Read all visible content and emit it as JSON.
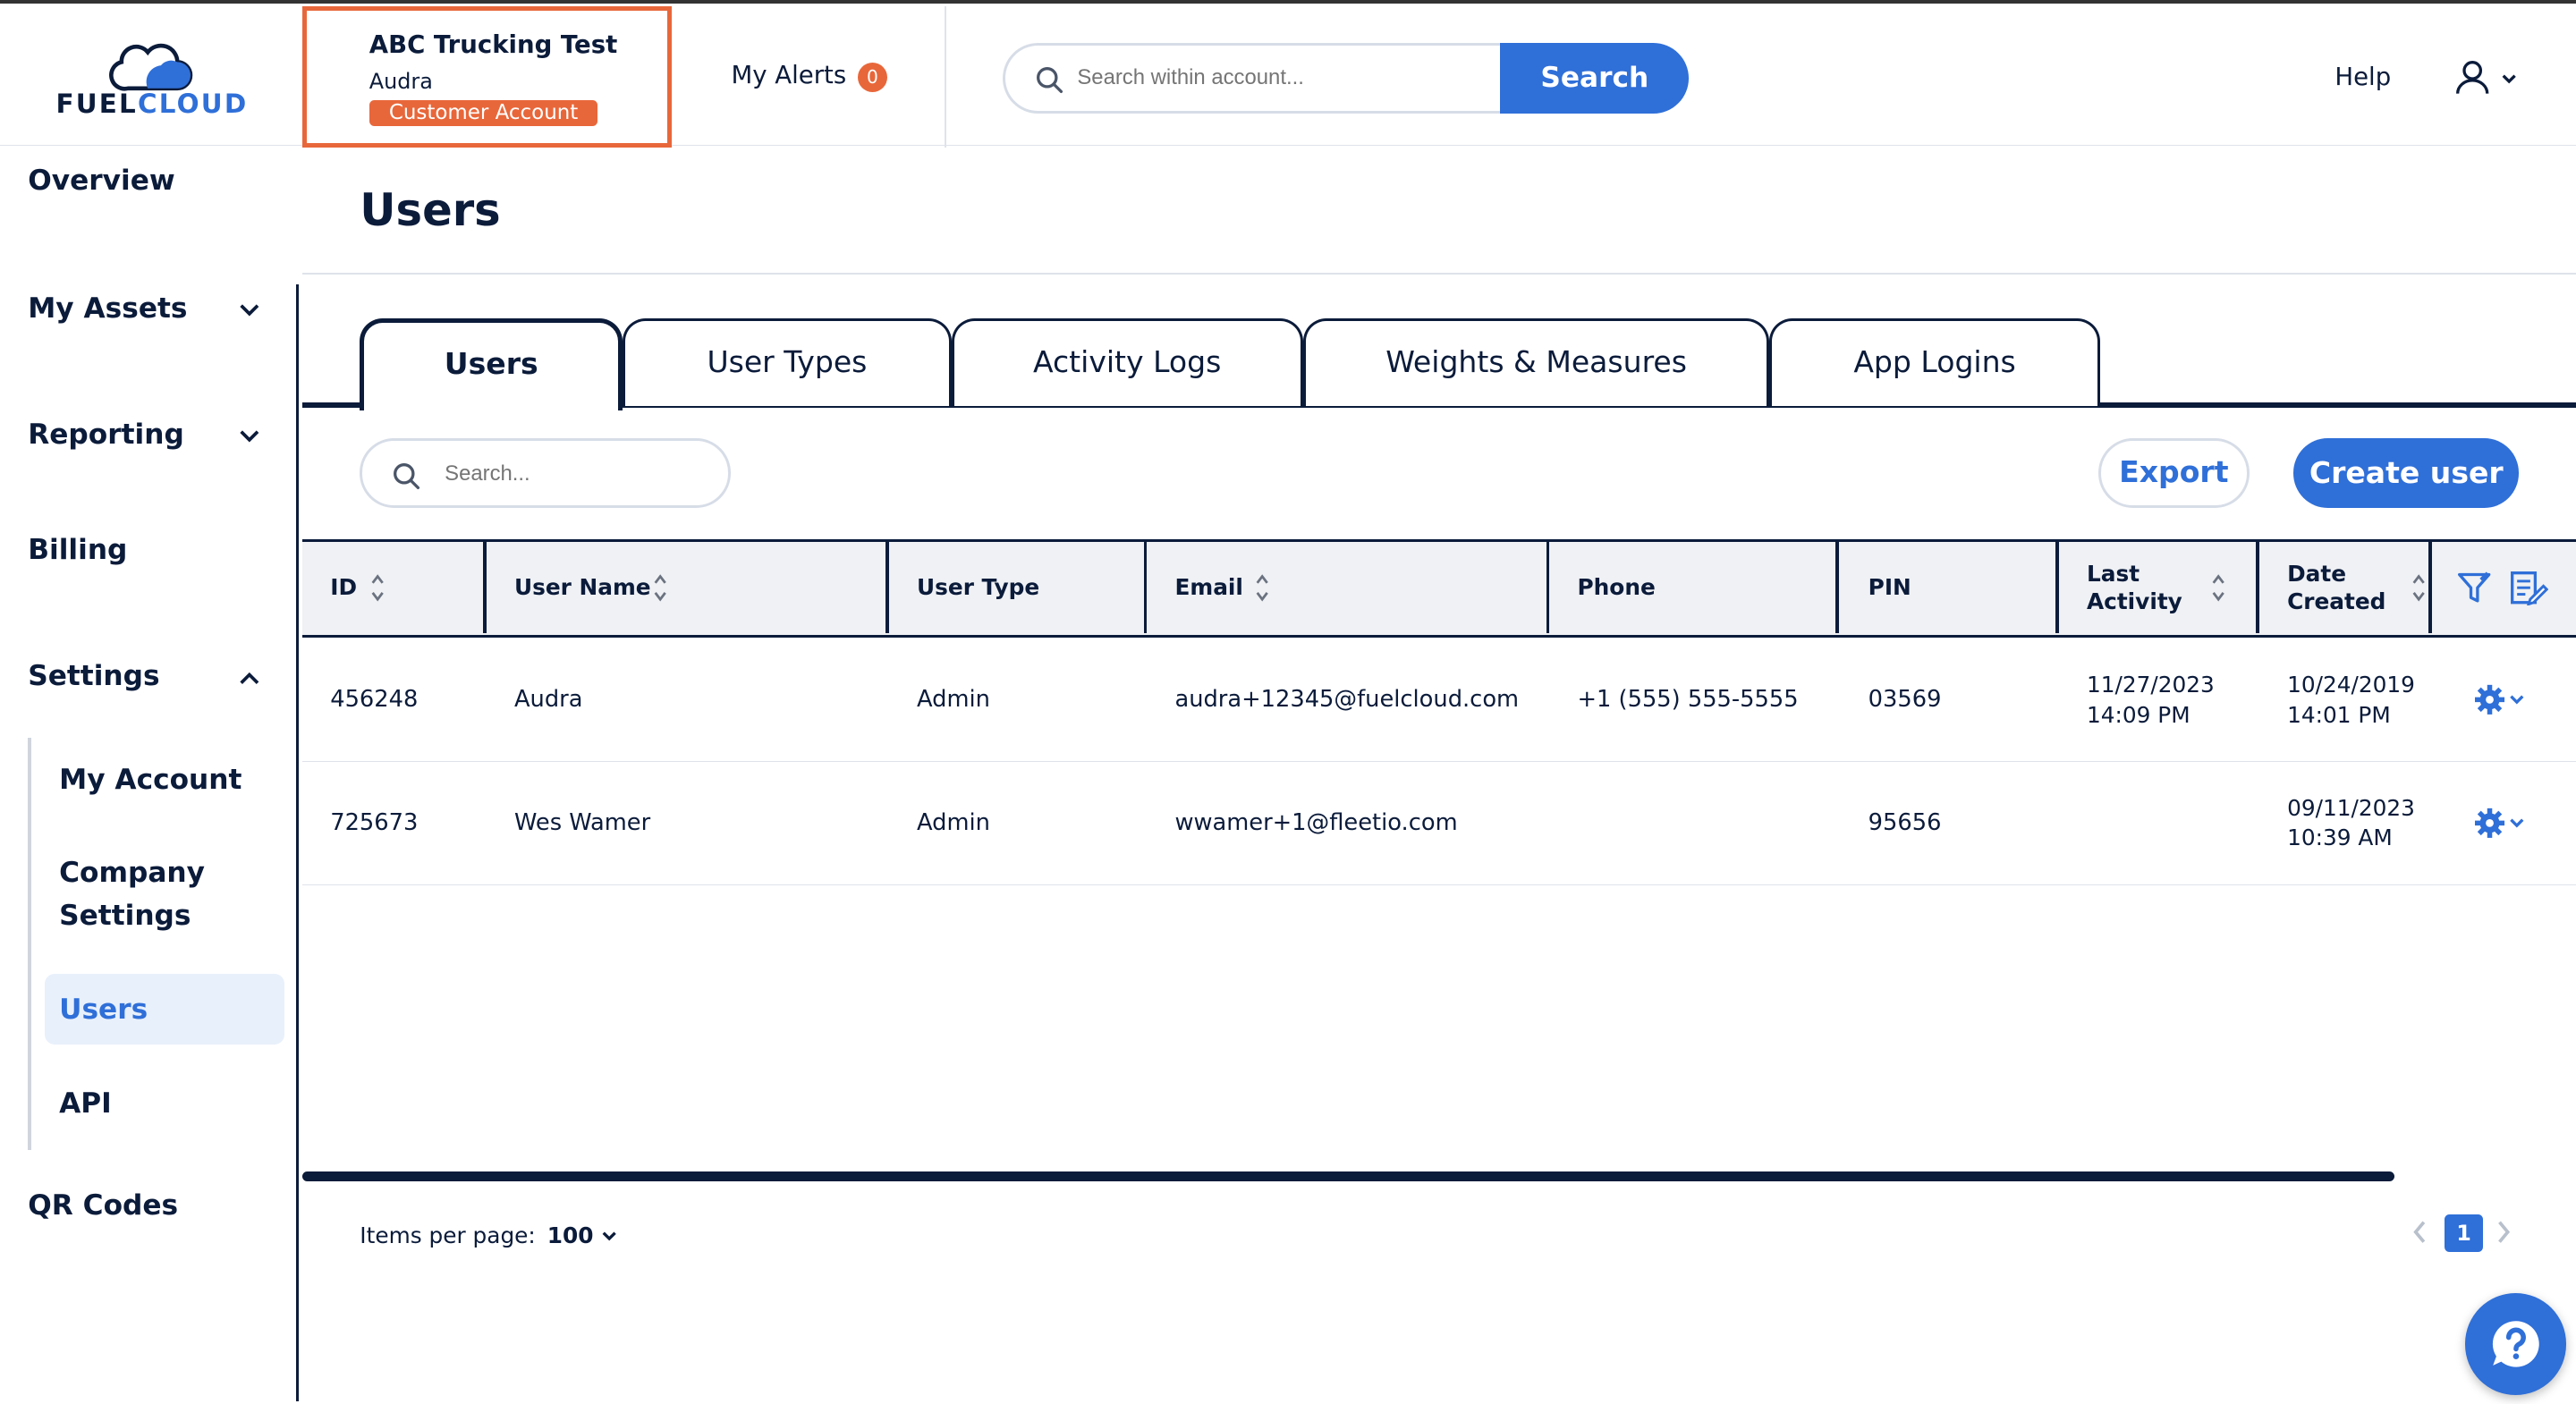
{
  "logo": {
    "text_part1": "FUEL",
    "text_part2": "CLOUD"
  },
  "account": {
    "name": "ABC Trucking Test",
    "user": "Audra",
    "badge": "Customer Account"
  },
  "alerts": {
    "label": "My Alerts",
    "count": "0"
  },
  "global_search": {
    "placeholder": "Search within account...",
    "button": "Search"
  },
  "header": {
    "help": "Help"
  },
  "sidebar": {
    "overview": "Overview",
    "my_assets": "My Assets",
    "reporting": "Reporting",
    "billing": "Billing",
    "settings": "Settings",
    "sub": {
      "my_account": "My Account",
      "company_settings_1": "Company",
      "company_settings_2": "Settings",
      "users": "Users",
      "api": "API"
    },
    "qr_codes": "QR Codes"
  },
  "page": {
    "title": "Users"
  },
  "tabs": [
    "Users",
    "User Types",
    "Activity Logs",
    "Weights & Measures",
    "App Logins"
  ],
  "toolbar": {
    "search_placeholder": "Search...",
    "export": "Export",
    "create": "Create user"
  },
  "table": {
    "headers": {
      "id": "ID",
      "user_name": "User Name",
      "user_type": "User Type",
      "email": "Email",
      "phone": "Phone",
      "pin": "PIN",
      "last_activity_1": "Last",
      "last_activity_2": "Activity",
      "date_created_1": "Date",
      "date_created_2": "Created"
    },
    "rows": [
      {
        "id": "456248",
        "user_name": "Audra",
        "user_type": "Admin",
        "email": "audra+12345@fuelcloud.com",
        "phone": "+1 (555) 555-5555",
        "pin": "03569",
        "last_date": "11/27/2023",
        "last_time": "14:09 PM",
        "created_date": "10/24/2019",
        "created_time": "14:01 PM"
      },
      {
        "id": "725673",
        "user_name": "Wes Wamer",
        "user_type": "Admin",
        "email": "wwamer+1@fleetio.com",
        "phone": "",
        "pin": "95656",
        "last_date": "",
        "last_time": "",
        "created_date": "09/11/2023",
        "created_time": "10:39 AM"
      }
    ]
  },
  "pagination": {
    "items_per_page_label": "Items per page:",
    "items_per_page": "100",
    "current_page": "1"
  },
  "colors": {
    "accent": "#2f6fd8",
    "navy": "#0b1b3a",
    "orange": "#e8673a",
    "active_bg": "#e8f0fb"
  },
  "icons": [
    "cloud-logo-icon",
    "search-icon",
    "user-icon",
    "chevron-down-icon",
    "chevron-up-icon",
    "sort-icon",
    "filter-icon",
    "edit-columns-icon",
    "gear-icon",
    "chevron-left-icon",
    "chevron-right-icon",
    "help-chat-icon"
  ]
}
